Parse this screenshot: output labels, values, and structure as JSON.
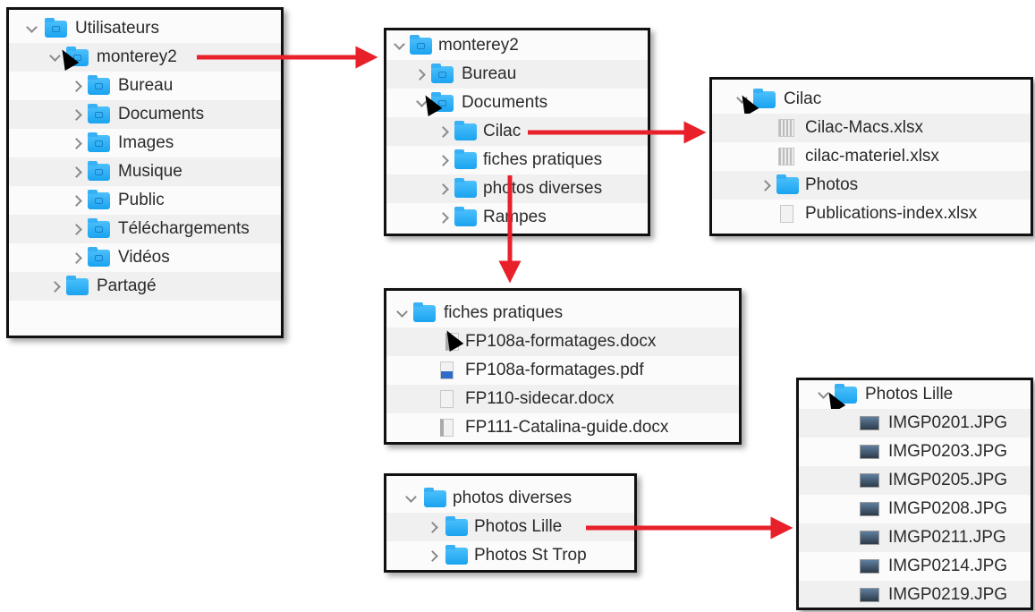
{
  "panel_users": {
    "rows": [
      "Utilisateurs",
      "monterey2",
      "Bureau",
      "Documents",
      "Images",
      "Musique",
      "Public",
      "Téléchargements",
      "Vidéos",
      "Partagé"
    ]
  },
  "panel_monterey": {
    "rows": [
      "monterey2",
      "Bureau",
      "Documents",
      "Cilac",
      "fiches pratiques",
      "photos diverses",
      "Rampes"
    ]
  },
  "panel_cilac": {
    "rows": [
      "Cilac",
      "Cilac-Macs.xlsx",
      "cilac-materiel.xlsx",
      "Photos",
      "Publications-index.xlsx"
    ]
  },
  "panel_fiches": {
    "rows": [
      "fiches pratiques",
      "FP108a-formatages.docx",
      "FP108a-formatages.pdf",
      "FP110-sidecar.docx",
      "FP111-Catalina-guide.docx"
    ]
  },
  "panel_photos": {
    "rows": [
      "photos diverses",
      "Photos Lille",
      "Photos St Trop"
    ]
  },
  "panel_lille": {
    "rows": [
      "Photos Lille",
      "IMGP0201.JPG",
      "IMGP0203.JPG",
      "IMGP0205.JPG",
      "IMGP0208.JPG",
      "IMGP0211.JPG",
      "IMGP0214.JPG",
      "IMGP0219.JPG"
    ]
  },
  "icons": {
    "folder": "folder-icon",
    "disclosure": "disclosure-triangle-icon",
    "cursor": "mouse-cursor-icon",
    "spreadsheet": "spreadsheet-file-icon",
    "document": "document-file-icon",
    "pdf": "pdf-file-icon",
    "image": "image-file-icon"
  },
  "colors": {
    "folder": "#1aa3f0",
    "arrow": "#e8202a",
    "panel_border": "#111111",
    "row_alt": "#f0f0f0"
  }
}
